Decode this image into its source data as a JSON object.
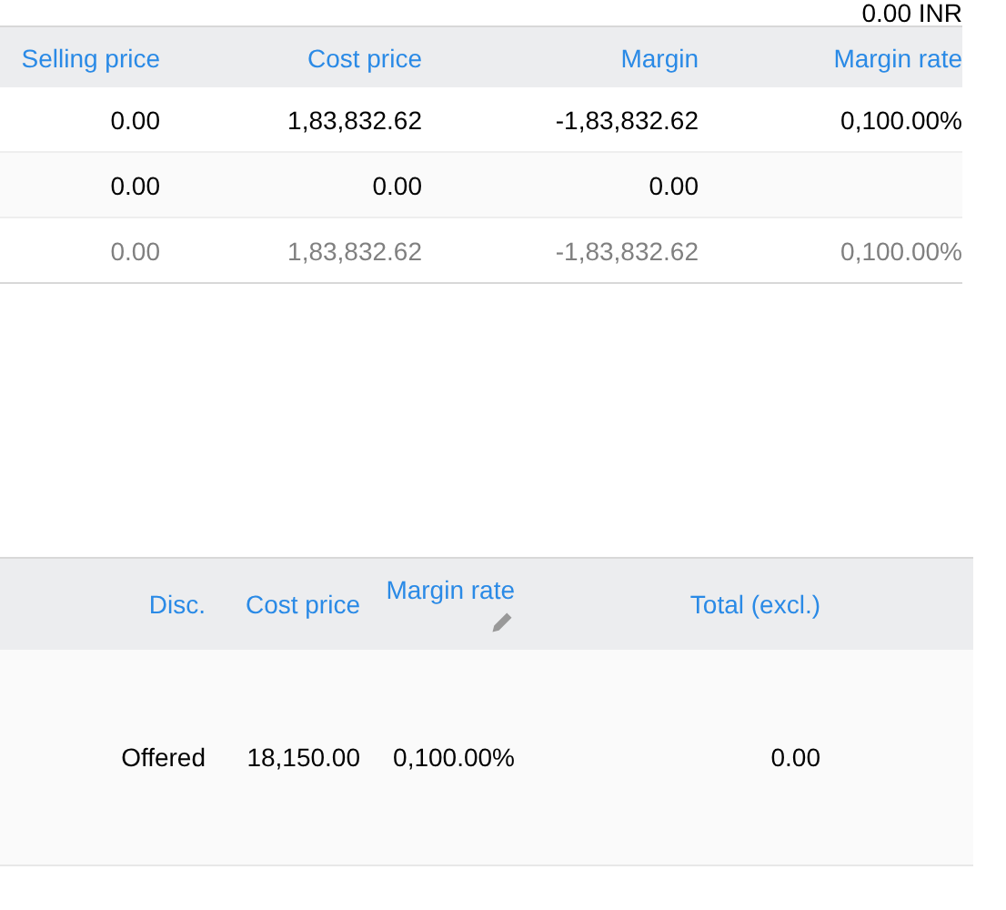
{
  "total_top": "0.00 INR",
  "summary_table": {
    "columns": [
      "Selling price",
      "Cost price",
      "Margin",
      "Margin rate"
    ],
    "rows": [
      {
        "cells": [
          "0.00",
          "1,83,832.62",
          "-1,83,832.62",
          "0,100.00%"
        ],
        "muted": false
      },
      {
        "cells": [
          "0.00",
          "0.00",
          "0.00",
          ""
        ],
        "muted": false
      },
      {
        "cells": [
          "0.00",
          "1,83,832.62",
          "-1,83,832.62",
          "0,100.00%"
        ],
        "muted": true
      }
    ]
  },
  "lines_table": {
    "columns": [
      {
        "label": "Disc.",
        "editable": false
      },
      {
        "label": "Cost price",
        "editable": false
      },
      {
        "label": "Margin rate",
        "editable": true
      },
      {
        "label": "Total (excl.)",
        "editable": false
      }
    ],
    "rows": [
      {
        "cells": [
          "Offered",
          "18,150.00",
          "0,100.00%",
          "0.00"
        ]
      }
    ]
  }
}
